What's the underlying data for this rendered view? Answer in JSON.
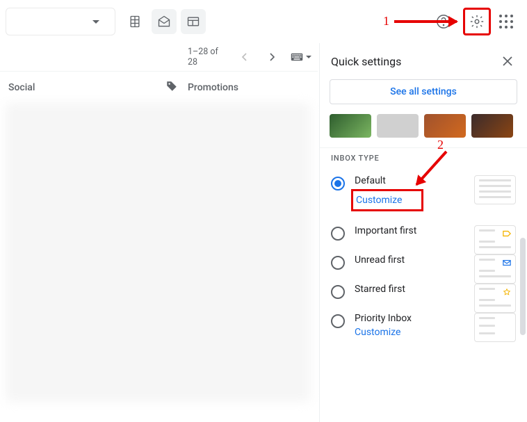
{
  "toolbar": {},
  "row2": {
    "pagination": "1–28 of 28"
  },
  "tabs": {
    "social": "Social",
    "promotions": "Promotions"
  },
  "panel": {
    "title": "Quick settings",
    "see_all": "See all settings",
    "section": "INBOX TYPE",
    "options": [
      {
        "label": "Default",
        "link": "Customize",
        "selected": true
      },
      {
        "label": "Important first"
      },
      {
        "label": "Unread first"
      },
      {
        "label": "Starred first"
      },
      {
        "label": "Priority Inbox",
        "link": "Customize"
      }
    ]
  },
  "annotations": {
    "n1": "1",
    "n2": "2"
  }
}
